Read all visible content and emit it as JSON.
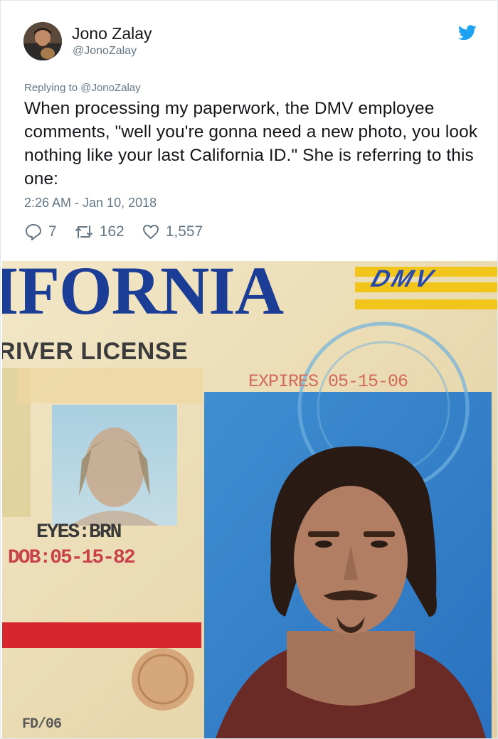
{
  "tweet": {
    "author": {
      "display_name": "Jono Zalay",
      "handle": "@JonoZalay"
    },
    "replying_to": "Replying to @JonoZalay",
    "text": "When processing my paperwork, the DMV employee comments, \"well you're gonna need a new photo, you look nothing like your last California ID.\" She is referring to this one:",
    "timestamp": "2:26 AM - Jan 10, 2018",
    "actions": {
      "replies": "7",
      "retweets": "162",
      "likes": "1,557"
    },
    "icons": {
      "brand": "twitter-bird-icon",
      "reply": "reply-bubble-icon",
      "retweet": "retweet-arrows-icon",
      "like": "heart-icon"
    },
    "colors": {
      "brand_blue": "#1da1f2",
      "secondary_text": "#657786",
      "primary_text": "#14171a"
    }
  },
  "photo": {
    "state_word": "IFORNIA",
    "dmv_logo": "DMV",
    "license_label": "RIVER LICENSE",
    "expires": "EXPIRES 05-15-06",
    "eyes": "EYES:BRN",
    "dob": "DOB:05-15-82",
    "footer_code": "FD/06"
  }
}
